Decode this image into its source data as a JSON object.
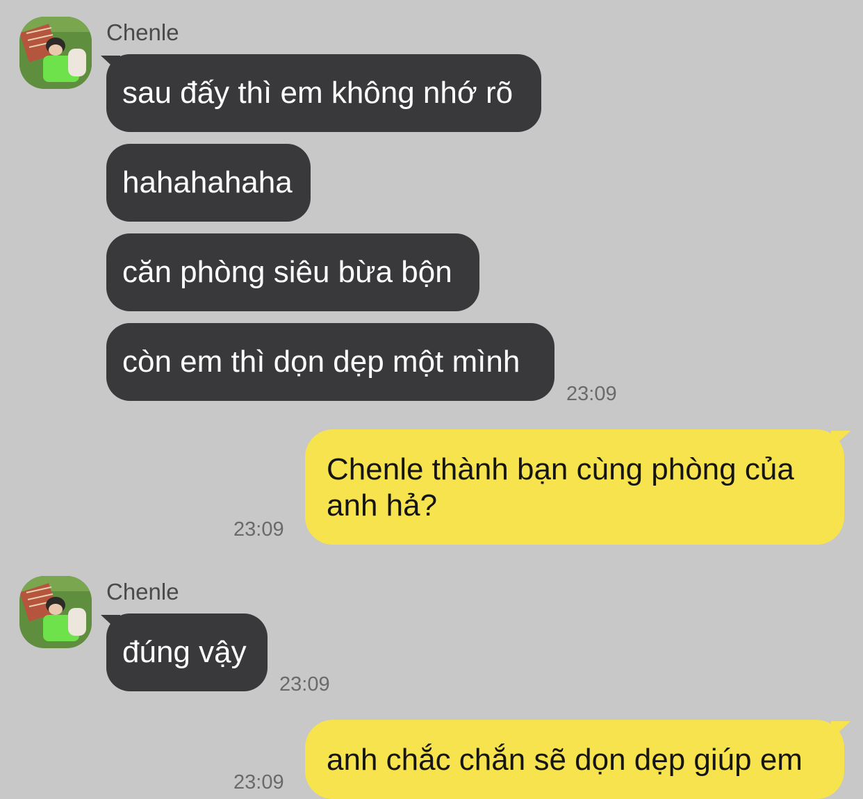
{
  "chat": {
    "sender_name": "Chenle",
    "colors": {
      "background": "#c8c8c8",
      "incoming_bubble": "#39393b",
      "outgoing_bubble": "#f7e34d",
      "timestamp": "#6a6a6a"
    },
    "groups": [
      {
        "direction": "incoming",
        "sender": "Chenle",
        "messages": [
          "sau đấy thì em không nhớ rõ",
          "hahahahaha",
          "căn phòng siêu bừa bộn",
          "còn em thì dọn dẹp một mình"
        ],
        "time": "23:09"
      },
      {
        "direction": "outgoing",
        "messages": [
          {
            "line1": "Chenle thành bạn cùng phòng của",
            "line2": "anh hả?"
          }
        ],
        "time": "23:09"
      },
      {
        "direction": "incoming",
        "sender": "Chenle",
        "messages": [
          "đúng vậy"
        ],
        "time": "23:09"
      },
      {
        "direction": "outgoing",
        "messages": [
          "anh chắc chắn sẽ dọn dẹp giúp em"
        ],
        "time": "23:09"
      }
    ]
  }
}
